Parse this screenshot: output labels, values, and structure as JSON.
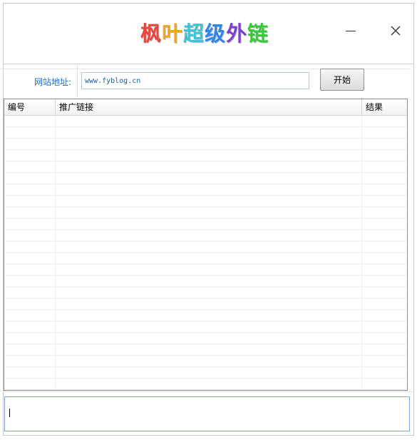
{
  "window": {
    "title_chars": [
      {
        "char": "枫",
        "color": "#e8453c"
      },
      {
        "char": "叶",
        "color": "#f2a51a"
      },
      {
        "char": "超",
        "color": "#3ec3d6"
      },
      {
        "char": "级",
        "color": "#2f86e6"
      },
      {
        "char": "外",
        "color": "#7b3fd1"
      },
      {
        "char": "链",
        "color": "#35c93a"
      }
    ]
  },
  "toolbar": {
    "url_label": "网站地址:",
    "url_value": "www.fyblog.cn",
    "start_label": "开始"
  },
  "grid": {
    "columns": [
      "编号",
      "推广链接",
      "结果"
    ],
    "rows": [
      {},
      {},
      {},
      {},
      {},
      {},
      {},
      {},
      {},
      {},
      {},
      {},
      {},
      {},
      {},
      {},
      {},
      {},
      {},
      {},
      {},
      {},
      {},
      {}
    ]
  },
  "log": {
    "text": ""
  }
}
